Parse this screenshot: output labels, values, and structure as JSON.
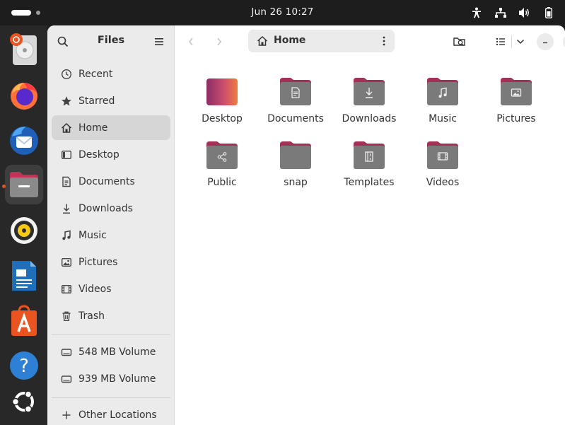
{
  "topbar": {
    "clock": "Jun 26  10:27",
    "tray_icons": [
      "accessibility-icon",
      "network-icon",
      "volume-icon",
      "battery-icon"
    ]
  },
  "dock": {
    "items": [
      {
        "name": "disk-installer-icon",
        "label": "Install"
      },
      {
        "name": "firefox-icon",
        "label": "Firefox"
      },
      {
        "name": "thunderbird-icon",
        "label": "Thunderbird"
      },
      {
        "name": "files-icon",
        "label": "Files",
        "active": true
      },
      {
        "name": "rhythmbox-icon",
        "label": "Rhythmbox"
      },
      {
        "name": "writer-icon",
        "label": "Writer"
      },
      {
        "name": "app-center-icon",
        "label": "App Center"
      },
      {
        "name": "help-icon",
        "label": "Help"
      },
      {
        "name": "ubuntu-logo-icon",
        "label": "Show Apps"
      }
    ]
  },
  "sidebar": {
    "title": "Files",
    "items": [
      {
        "label": "Recent",
        "icon": "clock-icon"
      },
      {
        "label": "Starred",
        "icon": "star-icon"
      },
      {
        "label": "Home",
        "icon": "home-icon",
        "selected": true
      },
      {
        "label": "Desktop",
        "icon": "desktop-icon"
      },
      {
        "label": "Documents",
        "icon": "document-icon"
      },
      {
        "label": "Downloads",
        "icon": "download-icon"
      },
      {
        "label": "Music",
        "icon": "music-icon"
      },
      {
        "label": "Pictures",
        "icon": "picture-icon"
      },
      {
        "label": "Videos",
        "icon": "video-icon"
      },
      {
        "label": "Trash",
        "icon": "trash-icon"
      }
    ],
    "volumes": [
      {
        "label": "548 MB Volume",
        "icon": "drive-icon"
      },
      {
        "label": "939 MB Volume",
        "icon": "drive-icon"
      }
    ],
    "other": {
      "label": "Other Locations",
      "icon": "plus-icon"
    }
  },
  "header": {
    "path_label": "Home"
  },
  "files": [
    {
      "name": "Desktop",
      "emblem": "none",
      "style": "desktop"
    },
    {
      "name": "Documents",
      "emblem": "document"
    },
    {
      "name": "Downloads",
      "emblem": "download"
    },
    {
      "name": "Music",
      "emblem": "music"
    },
    {
      "name": "Pictures",
      "emblem": "picture"
    },
    {
      "name": "Public",
      "emblem": "share"
    },
    {
      "name": "snap",
      "emblem": "none"
    },
    {
      "name": "Templates",
      "emblem": "template"
    },
    {
      "name": "Videos",
      "emblem": "video"
    }
  ],
  "colors": {
    "accent": "#e95420",
    "folder_tab": "#a52f55",
    "folder_body": "#7a7a7a"
  }
}
